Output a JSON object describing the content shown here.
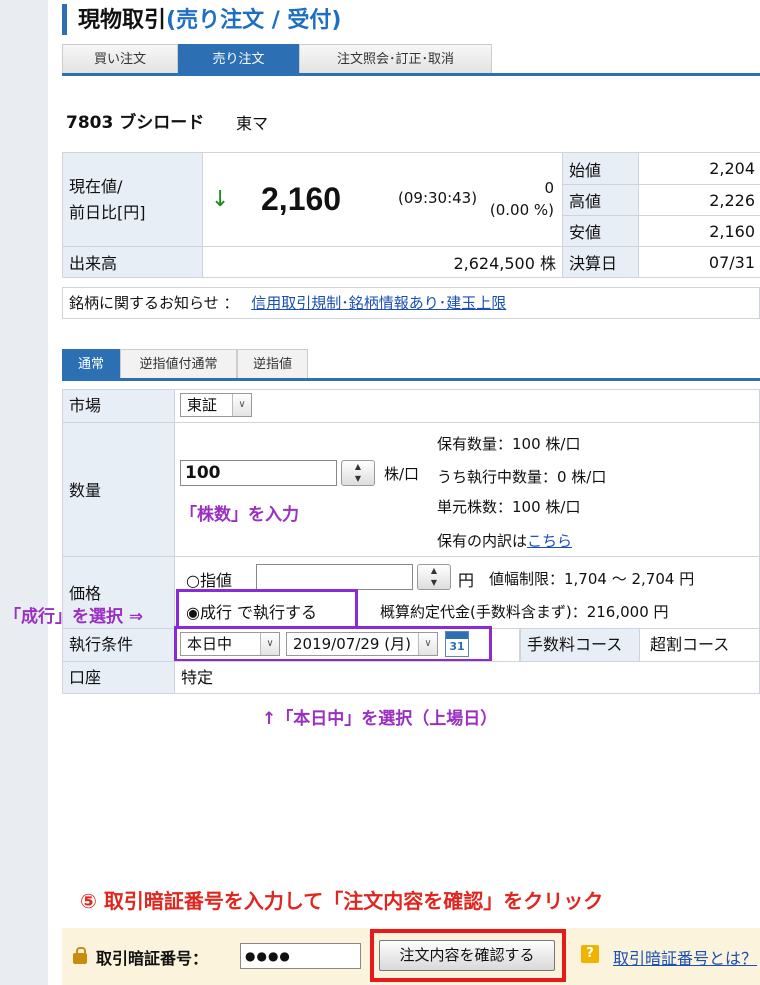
{
  "page": {
    "title_main": "現物取引",
    "title_sub": "(売り注文 / 受付)"
  },
  "tabs_top": [
    {
      "label": "買い注文",
      "active": false
    },
    {
      "label": "売り注文",
      "active": true
    },
    {
      "label": "注文照会･訂正･取消",
      "active": false
    }
  ],
  "stock": {
    "code_name": "7803 ブシロード",
    "market": "東マ"
  },
  "price": {
    "label_line1": "現在値/",
    "label_line2": "前日比[円]",
    "direction_icon": "down-arrow-icon",
    "direction_glyph": "↓",
    "current": "2,160",
    "time": "(09:30:43)",
    "change": "0",
    "change_pct": "(0.00 %)",
    "volume_label": "出来高",
    "volume": "2,624,500 株",
    "open_label": "始値",
    "open": "2,204",
    "high_label": "高値",
    "high": "2,226",
    "low_label": "安値",
    "low": "2,160",
    "settle_label": "決算日",
    "settle": "07/31"
  },
  "notice": {
    "label": "銘柄に関するお知らせ ：",
    "link": "信用取引規制･銘柄情報あり･建玉上限"
  },
  "order_tabs": [
    {
      "label": "通常",
      "active": true
    },
    {
      "label": "逆指値付通常",
      "active": false
    },
    {
      "label": "逆指値",
      "active": false
    }
  ],
  "form": {
    "market_label": "市場",
    "market_value": "東証",
    "qty_label": "数量",
    "qty_value": "100",
    "qty_unit": "株/口",
    "held_qty": "保有数量：100 株/口",
    "executing_qty": "うち執行中数量：0 株/口",
    "unit_qty": "単元株数：100 株/口",
    "breakdown_prefix": "保有の内訳は",
    "breakdown_link": "こちら",
    "price_label": "価格",
    "limit_label": "○指値",
    "limit_value": "",
    "yen": "円",
    "price_range": "値幅制限：1,704 〜 2,704 円",
    "market_order_label": "◉成行 で執行する",
    "estimate": "概算約定代金(手数料含まず)：216,000 円",
    "condition_label": "執行条件",
    "condition_value": "本日中",
    "date_value": "2019/07/29 (月)",
    "calendar_day": "31",
    "fee_label": "手数料コース",
    "fee_value": "超割コース",
    "account_label": "口座",
    "account_value": "特定"
  },
  "annotations": {
    "qty_hint": "「株数」を入力",
    "market_hint": "「成行」を選択 ⇒",
    "today_hint": "↑「本日中」を選択（上場日）",
    "step5": "⑤ 取引暗証番号を入力して「注文内容を確認」をクリック"
  },
  "bottom": {
    "pin_label": "取引暗証番号：",
    "pin_value": "●●●●",
    "confirm_button": "注文内容を確認する",
    "help_link": "取引暗証番号とは？"
  },
  "colors": {
    "accent_blue": "#2c6fb2",
    "annotation_purple": "#9a2fc2",
    "annotation_red": "#e0261e",
    "price_down_green": "#1a8a1a"
  }
}
